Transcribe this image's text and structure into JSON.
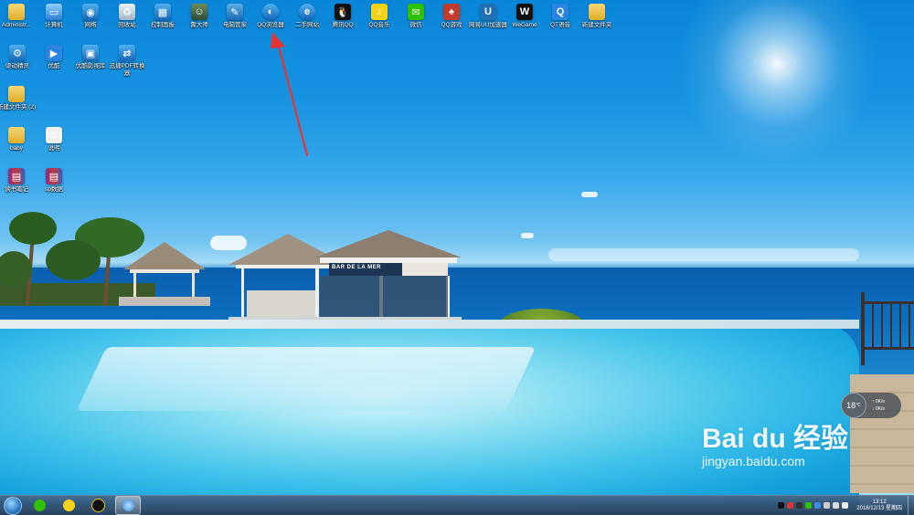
{
  "desktop": {
    "icons_row1": [
      {
        "label": "Administr...",
        "icon": "user-folder-icon"
      },
      {
        "label": "计算机",
        "icon": "computer-icon"
      },
      {
        "label": "网络",
        "icon": "network-icon"
      },
      {
        "label": "回收站",
        "icon": "recycle-bin-icon"
      },
      {
        "label": "控制面板",
        "icon": "control-panel-icon"
      },
      {
        "label": "鲁大师",
        "icon": "ludashi-icon"
      },
      {
        "label": "电脑管家",
        "icon": "pc-manager-icon"
      },
      {
        "label": "QQ浏览器",
        "icon": "qq-browser-icon"
      },
      {
        "label": "二手网站",
        "icon": "ie-icon"
      },
      {
        "label": "腾讯QQ",
        "icon": "qq-penguin-icon"
      },
      {
        "label": "QQ音乐",
        "icon": "qq-music-icon"
      },
      {
        "label": "微信",
        "icon": "wechat-icon"
      },
      {
        "label": "QQ游戏",
        "icon": "qq-game-icon"
      },
      {
        "label": "网易UU加速器",
        "icon": "netease-uu-icon"
      },
      {
        "label": "WeGame",
        "icon": "wegame-icon"
      },
      {
        "label": "QT语音",
        "icon": "qt-voice-icon"
      },
      {
        "label": "新建文件夹",
        "icon": "folder-icon"
      }
    ],
    "icons_row2": [
      {
        "label": "驱动精灵",
        "icon": "driver-icon"
      },
      {
        "label": "优酷",
        "icon": "youku-icon"
      },
      {
        "label": "优酷影视库",
        "icon": "video-library-icon"
      },
      {
        "label": "迅捷PDF转换器",
        "icon": "pdf-converter-icon"
      }
    ],
    "icons_col": [
      {
        "label": "新建文件夹 (2)",
        "icon": "folder-icon"
      },
      {
        "label": "baby",
        "icon": "folder-icon"
      },
      {
        "label": "说明",
        "icon": "text-file-icon"
      },
      {
        "label": "读书笔记",
        "icon": "rar-archive-icon"
      },
      {
        "label": "sp数据",
        "icon": "rar-archive-icon"
      }
    ]
  },
  "wallpaper": {
    "sign_text": "BAR DE LA MER"
  },
  "watermark": {
    "logo": "Bai du 经验",
    "url": "jingyan.baidu.com"
  },
  "net_widget": {
    "temp": "18",
    "unit": "℃",
    "up": "0K/s",
    "down": "0K/s"
  },
  "taskbar": {
    "clock_time": "13:12",
    "clock_date": "2018/12/13 星期四"
  },
  "colors": {
    "arrow": "#e8332e",
    "taskbar": "#2e4d6e"
  }
}
